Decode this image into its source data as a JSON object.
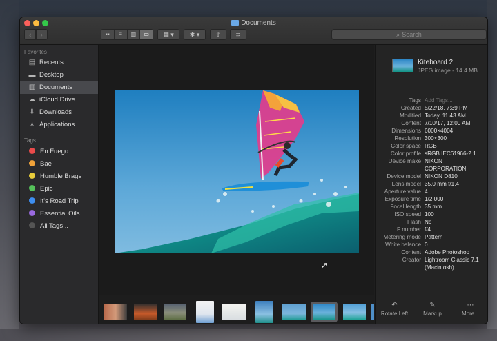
{
  "window": {
    "title": "Documents"
  },
  "toolbar": {
    "back_icon": "‹",
    "forward_icon": "›",
    "views": [
      "▪▪",
      "≡",
      "▥",
      "▭"
    ],
    "group_icon": "▦ ▾",
    "action_icon": "✱ ▾",
    "share_icon": "⇧",
    "tag_icon": "⊃",
    "search_placeholder": "Search"
  },
  "sidebar": {
    "favorites_header": "Favorites",
    "favorites": [
      {
        "label": "Recents",
        "icon": "▤"
      },
      {
        "label": "Desktop",
        "icon": "▬"
      },
      {
        "label": "Documents",
        "icon": "▥",
        "selected": true
      },
      {
        "label": "iCloud Drive",
        "icon": "☁"
      },
      {
        "label": "Downloads",
        "icon": "⬇"
      },
      {
        "label": "Applications",
        "icon": "⋏"
      }
    ],
    "tags_header": "Tags",
    "tags": [
      {
        "label": "En Fuego",
        "color": "#e94b4b"
      },
      {
        "label": "Bae",
        "color": "#f0a23a"
      },
      {
        "label": "Humble Brags",
        "color": "#e8cc3b"
      },
      {
        "label": "Epic",
        "color": "#55c15a"
      },
      {
        "label": "It's Road Trip",
        "color": "#3e8ef0"
      },
      {
        "label": "Essential Oils",
        "color": "#9a6ae0"
      },
      {
        "label": "All Tags...",
        "color": "#555555"
      }
    ]
  },
  "inspector": {
    "name": "Kiteboard 2",
    "kind": "JPEG image - 14.4 MB",
    "metadata": [
      {
        "key": "Tags",
        "value": "Add Tags...",
        "placeholder": true
      },
      {
        "key": "Created",
        "value": "5/22/18, 7:39 PM"
      },
      {
        "key": "Modified",
        "value": "Today, 11:43 AM"
      },
      {
        "key": "Content",
        "value": "7/10/17, 12:00 AM"
      },
      {
        "key": "Dimensions",
        "value": "6000×4004"
      },
      {
        "key": "Resolution",
        "value": "300×300"
      },
      {
        "key": "Color space",
        "value": "RGB"
      },
      {
        "key": "Color profile",
        "value": "sRGB IEC61966-2.1"
      },
      {
        "key": "Device make",
        "value": "NIKON\nCORPORATION"
      },
      {
        "key": "Device model",
        "value": "NIKON D810"
      },
      {
        "key": "Lens model",
        "value": "35.0 mm f/1.4"
      },
      {
        "key": "Aperture value",
        "value": "4"
      },
      {
        "key": "Exposure time",
        "value": "1/2,000"
      },
      {
        "key": "Focal length",
        "value": "35 mm"
      },
      {
        "key": "ISO speed",
        "value": "100"
      },
      {
        "key": "Flash",
        "value": "No"
      },
      {
        "key": "F number",
        "value": "f/4"
      },
      {
        "key": "Metering mode",
        "value": "Pattern"
      },
      {
        "key": "White balance",
        "value": "0"
      },
      {
        "key": "Content",
        "value": "Adobe Photoshop"
      },
      {
        "key": "Creator",
        "value": "Lightroom Classic 7.1\n(Macintosh)"
      }
    ],
    "actions": [
      {
        "label": "Rotate Left",
        "icon": "↶"
      },
      {
        "label": "Markup",
        "icon": "✎"
      },
      {
        "label": "More...",
        "icon": "⋯"
      }
    ]
  }
}
